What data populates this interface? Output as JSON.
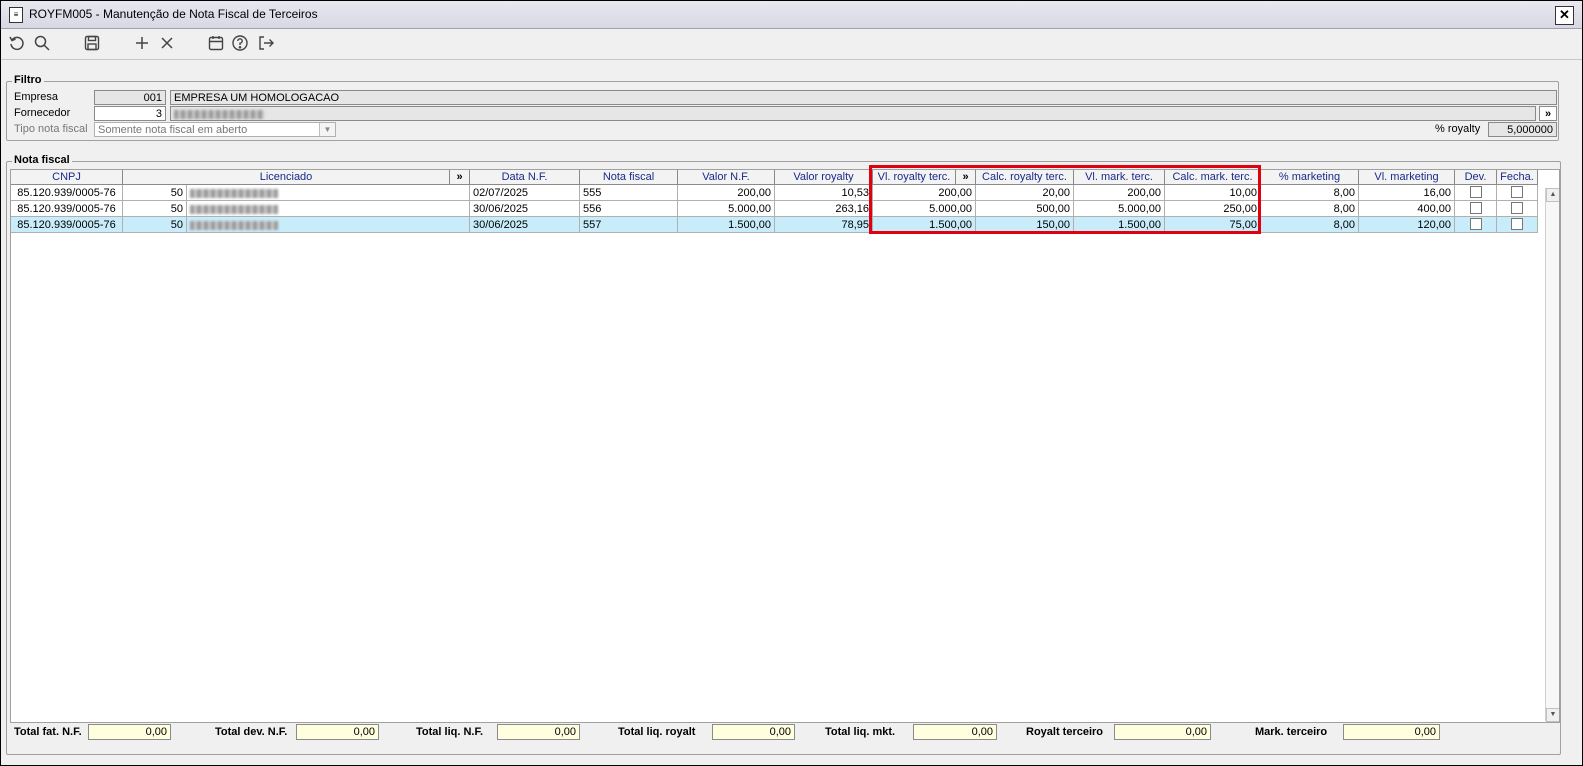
{
  "window": {
    "title": "ROYFM005 - Manutenção de Nota Fiscal de Terceiros",
    "close": "✕"
  },
  "toolbar": {
    "icons": [
      "undo-icon",
      "search-icon",
      "save-icon",
      "add-icon",
      "delete-icon",
      "calendar-icon",
      "help-icon",
      "exit-icon"
    ]
  },
  "filtro": {
    "legend": "Filtro",
    "empresa_label": "Empresa",
    "empresa_code": "001",
    "empresa_name": "EMPRESA UM HOMOLOGACAO",
    "fornecedor_label": "Fornecedor",
    "fornecedor_code": "3",
    "fornecedor_more": "»",
    "tipo_label": "Tipo nota fiscal",
    "tipo_value": "Somente nota fiscal em aberto",
    "royalty_label": "% royalty",
    "royalty_value": "5,000000"
  },
  "grid": {
    "legend": "Nota fiscal",
    "headers": {
      "cnpj": "CNPJ",
      "licenciado": "Licenciado",
      "more1": "»",
      "data": "Data N.F.",
      "nota": "Nota fiscal",
      "valor": "Valor N.F.",
      "valor_royalty": "Valor royalty",
      "vl_royalty_terc": "Vl. royalty terc.",
      "more2": "»",
      "calc_royalty_terc": "Calc. royalty terc.",
      "vl_mark_terc": "Vl. mark. terc.",
      "calc_mark_terc": "Calc. mark. terc.",
      "pct_marketing": "% marketing",
      "vl_marketing": "Vl. marketing",
      "dev": "Dev.",
      "fecha": "Fecha."
    },
    "rows": [
      {
        "cnpj": "85.120.939/0005-76",
        "lic_code": "50",
        "data": "02/07/2025",
        "nota": "555",
        "valor": "200,00",
        "valor_royalty": "10,53",
        "vl_royalty_terc": "200,00",
        "calc_royalty_terc": "20,00",
        "vl_mark_terc": "200,00",
        "calc_mark_terc": "10,00",
        "pct_marketing": "8,00",
        "vl_marketing": "16,00"
      },
      {
        "cnpj": "85.120.939/0005-76",
        "lic_code": "50",
        "data": "30/06/2025",
        "nota": "556",
        "valor": "5.000,00",
        "valor_royalty": "263,16",
        "vl_royalty_terc": "5.000,00",
        "calc_royalty_terc": "500,00",
        "vl_mark_terc": "5.000,00",
        "calc_mark_terc": "250,00",
        "pct_marketing": "8,00",
        "vl_marketing": "400,00"
      },
      {
        "cnpj": "85.120.939/0005-76",
        "lic_code": "50",
        "data": "30/06/2025",
        "nota": "557",
        "valor": "1.500,00",
        "valor_royalty": "78,95",
        "vl_royalty_terc": "1.500,00",
        "calc_royalty_terc": "150,00",
        "vl_mark_terc": "1.500,00",
        "calc_mark_terc": "75,00",
        "pct_marketing": "8,00",
        "vl_marketing": "120,00"
      }
    ]
  },
  "totals": {
    "fat_label": "Total fat. N.F.",
    "fat_value": "0,00",
    "dev_label": "Total dev. N.F.",
    "dev_value": "0,00",
    "liq_label": "Total liq. N.F.",
    "liq_value": "0,00",
    "liq_royalt_label": "Total liq. royalt",
    "liq_royalt_value": "0,00",
    "liq_mkt_label": "Total liq. mkt.",
    "liq_mkt_value": "0,00",
    "royalt_terc_label": "Royalt terceiro",
    "royalt_terc_value": "0,00",
    "mark_terc_label": "Mark. terceiro",
    "mark_terc_value": "0,00"
  },
  "colors": {
    "highlight_border": "#e00010",
    "selected_row": "#c8ecfa",
    "header_text": "#1a2a8a",
    "total_field": "#ffffe0"
  }
}
